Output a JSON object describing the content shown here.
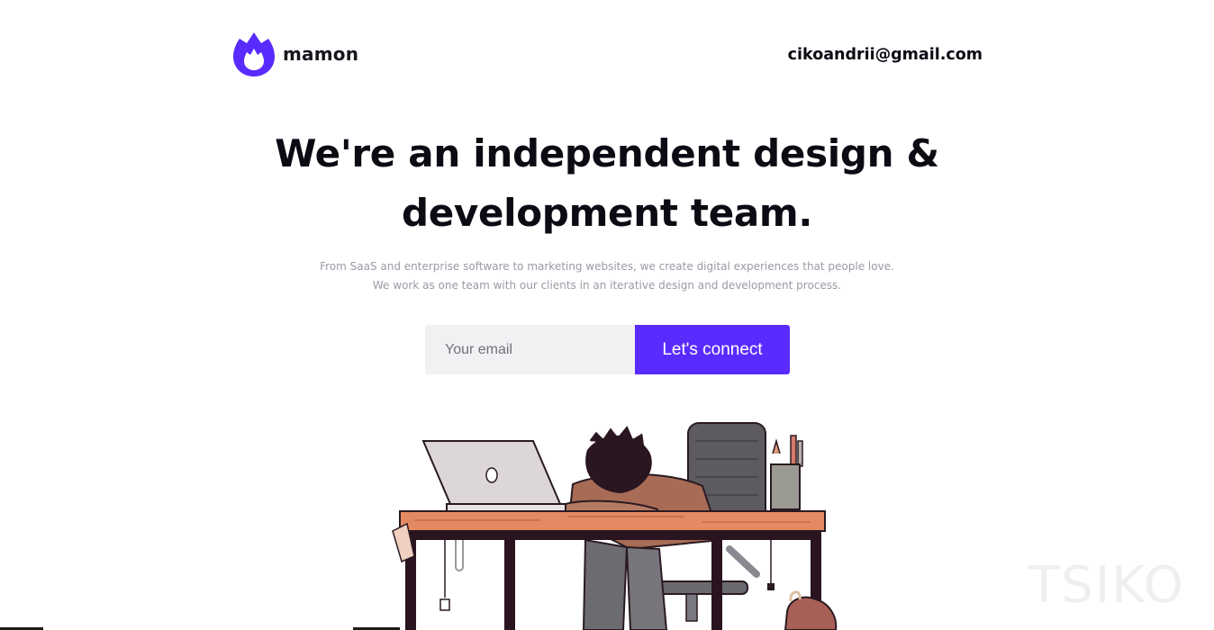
{
  "brand": {
    "name": "mamon",
    "accent": "#5a2bff"
  },
  "header": {
    "email": "cikoandrii@gmail.com"
  },
  "hero": {
    "headline_line1": "We're an independent design &",
    "headline_line2": "development team.",
    "sub_line1": "From SaaS and enterprise software to marketing websites, we create digital experiences that people love.",
    "sub_line2": "We work as one team with our clients in an iterative design and development process."
  },
  "signup": {
    "placeholder": "Your email",
    "button_label": "Let's connect"
  },
  "watermark": "TSIKO"
}
